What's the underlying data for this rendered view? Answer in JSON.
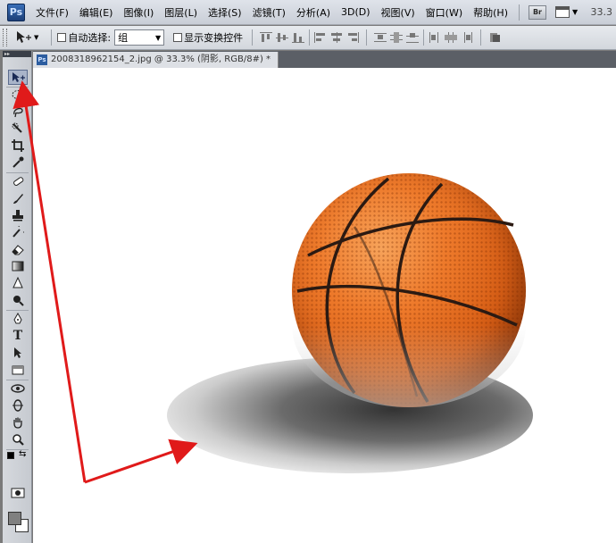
{
  "app": {
    "logo": "Ps"
  },
  "menubar": {
    "items": [
      "文件(F)",
      "编辑(E)",
      "图像(I)",
      "图层(L)",
      "选择(S)",
      "滤镜(T)",
      "分析(A)",
      "3D(D)",
      "视图(V)",
      "窗口(W)",
      "帮助(H)"
    ],
    "br_label": "Br",
    "zoom_value": "33.3"
  },
  "options": {
    "auto_select_label": "自动选择:",
    "auto_select_value": "组",
    "show_transform_label": "显示变换控件"
  },
  "document": {
    "tab_title": "20083189621​54_2.jpg @ 33.3% (阴影, RGB/8#) *"
  },
  "colors": {
    "accent": "#2c5da0",
    "arrow": "#e01a1a",
    "foreground": "#808080",
    "background": "#ffffff"
  },
  "tools": [
    "move-tool-icon",
    "marquee-icon",
    "lasso-icon",
    "quick-select-icon",
    "crop-icon",
    "eyedropper-icon",
    "healing-brush-icon",
    "brush-icon",
    "clone-stamp-icon",
    "history-brush-icon",
    "eraser-icon",
    "gradient-icon",
    "blur-icon",
    "dodge-icon",
    "pen-icon",
    "type-icon",
    "path-select-icon",
    "shape-icon",
    "3d-rotate-icon",
    "3d-orbit-icon",
    "hand-icon",
    "zoom-icon",
    "quick-mask-icon"
  ]
}
